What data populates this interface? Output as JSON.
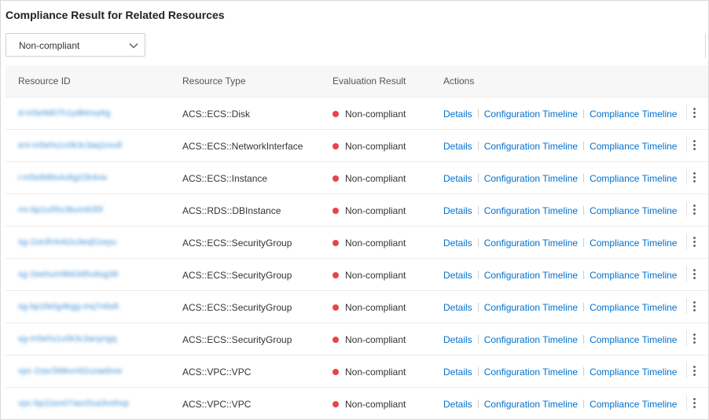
{
  "panel": {
    "title": "Compliance Result for Related Resources"
  },
  "filter": {
    "selected": "Non-compliant"
  },
  "table": {
    "columns": {
      "resource_id": "Resource ID",
      "resource_type": "Resource Type",
      "evaluation_result": "Evaluation Result",
      "actions": "Actions"
    },
    "action_labels": {
      "details": "Details",
      "configuration_timeline": "Configuration Timeline",
      "compliance_timeline": "Compliance Timeline"
    },
    "status_color": "#e84444",
    "rows": [
      {
        "id": "d-m5e9d07h1ydktnvy6g",
        "type": "ACS::ECS::Disk",
        "result": "Non-compliant"
      },
      {
        "id": "eni-m5ehs1v0k3c3aq1mu8",
        "type": "ACS::ECS::NetworkInterface",
        "result": "Non-compliant"
      },
      {
        "id": "i-m5e8d6s4u6g22k4vw",
        "type": "ACS::ECS::Instance",
        "result": "Non-compliant"
      },
      {
        "id": "rm-bp1u55x3bum635f",
        "type": "ACS::RDS::DBInstance",
        "result": "Non-compliant"
      },
      {
        "id": "sg-2ze3h4vb2u3eq51wyu",
        "type": "ACS::ECS::SecurityGroup",
        "result": "Non-compliant"
      },
      {
        "id": "sg-2eehum9kb3d5u6sg38",
        "type": "ACS::ECS::SecurityGroup",
        "result": "Non-compliant"
      },
      {
        "id": "sg-bp1fe0g4kgg-mq7n6s8",
        "type": "ACS::ECS::SecurityGroup",
        "result": "Non-compliant"
      },
      {
        "id": "sg-m5ehs1v0k3c3anyngq",
        "type": "ACS::ECS::SecurityGroup",
        "result": "Non-compliant"
      },
      {
        "id": "vpc-2zec5t6kvn92uzaebvw",
        "type": "ACS::VPC::VPC",
        "result": "Non-compliant"
      },
      {
        "id": "vpc-bp11wx07asx5ua3vohxp",
        "type": "ACS::VPC::VPC",
        "result": "Non-compliant"
      }
    ]
  }
}
